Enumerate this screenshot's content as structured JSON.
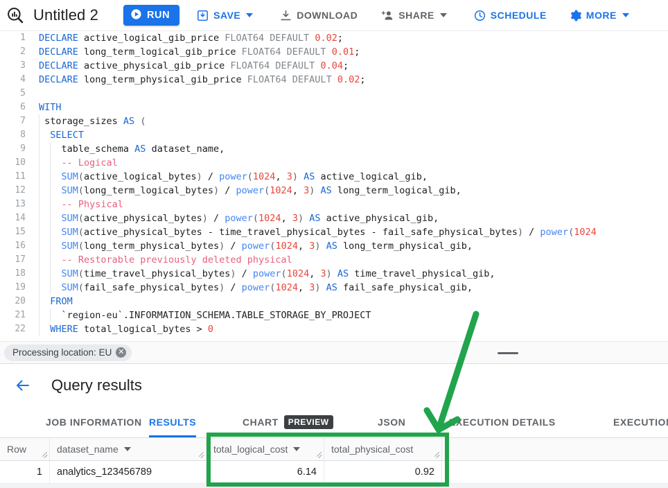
{
  "toolbar": {
    "logo_icon": "bigquery-search-icon",
    "title": "Untitled 2",
    "run_label": "RUN",
    "save_label": "SAVE",
    "download_label": "DOWNLOAD",
    "share_label": "SHARE",
    "schedule_label": "SCHEDULE",
    "more_label": "MORE",
    "accent_color": "#1a73e8",
    "disabled_color": "#5f6368"
  },
  "editor": {
    "lines": [
      {
        "n": "1",
        "html": "<span class='kw'>DECLARE</span> active_logical_gib_price <span class='typ'>FLOAT64</span> <span class='typ'>DEFAULT</span> <span class='num'>0.02</span>;"
      },
      {
        "n": "2",
        "html": "<span class='kw'>DECLARE</span> long_term_logical_gib_price <span class='typ'>FLOAT64</span> <span class='typ'>DEFAULT</span> <span class='num'>0.01</span>;"
      },
      {
        "n": "3",
        "html": "<span class='kw'>DECLARE</span> active_physical_gib_price <span class='typ'>FLOAT64</span> <span class='typ'>DEFAULT</span> <span class='num'>0.04</span>;"
      },
      {
        "n": "4",
        "html": "<span class='kw'>DECLARE</span> long_term_physical_gib_price <span class='typ'>FLOAT64</span> <span class='typ'>DEFAULT</span> <span class='num'>0.02</span>;"
      },
      {
        "n": "5",
        "html": ""
      },
      {
        "n": "6",
        "html": "<span class='kw'>WITH</span>"
      },
      {
        "n": "7",
        "html": " storage_sizes <span class='kw'>AS</span> <span class='pn'>(</span>"
      },
      {
        "n": "8",
        "html": "  <span class='kw'>SELECT</span>"
      },
      {
        "n": "9",
        "html": "    table_schema <span class='kw'>AS</span> dataset_name,"
      },
      {
        "n": "10",
        "html": "    <span class='cmt'>-- Logical</span>"
      },
      {
        "n": "11",
        "html": "    <span class='fn'>SUM</span><span class='pn'>(</span>active_logical_bytes<span class='pn'>)</span> / <span class='fn'>power</span><span class='pn'>(</span><span class='num'>1024</span>, <span class='num'>3</span><span class='pn'>)</span> <span class='kw'>AS</span> active_logical_gib,"
      },
      {
        "n": "12",
        "html": "    <span class='fn'>SUM</span><span class='pn'>(</span>long_term_logical_bytes<span class='pn'>)</span> / <span class='fn'>power</span><span class='pn'>(</span><span class='num'>1024</span>, <span class='num'>3</span><span class='pn'>)</span> <span class='kw'>AS</span> long_term_logical_gib,"
      },
      {
        "n": "13",
        "html": "    <span class='cmt'>-- Physical</span>"
      },
      {
        "n": "14",
        "html": "    <span class='fn'>SUM</span><span class='pn'>(</span>active_physical_bytes<span class='pn'>)</span> / <span class='fn'>power</span><span class='pn'>(</span><span class='num'>1024</span>, <span class='num'>3</span><span class='pn'>)</span> <span class='kw'>AS</span> active_physical_gib,"
      },
      {
        "n": "15",
        "html": "    <span class='fn'>SUM</span><span class='pn'>(</span>active_physical_bytes - time_travel_physical_bytes - fail_safe_physical_bytes<span class='pn'>)</span> / <span class='fn'>power</span><span class='pn'>(</span><span class='num'>1024</span>"
      },
      {
        "n": "16",
        "html": "    <span class='fn'>SUM</span><span class='pn'>(</span>long_term_physical_bytes<span class='pn'>)</span> / <span class='fn'>power</span><span class='pn'>(</span><span class='num'>1024</span>, <span class='num'>3</span><span class='pn'>)</span> <span class='kw'>AS</span> long_term_physical_gib,"
      },
      {
        "n": "17",
        "html": "    <span class='cmt'>-- Restorable previously deleted physical</span>"
      },
      {
        "n": "18",
        "html": "    <span class='fn'>SUM</span><span class='pn'>(</span>time_travel_physical_bytes<span class='pn'>)</span> / <span class='fn'>power</span><span class='pn'>(</span><span class='num'>1024</span>, <span class='num'>3</span><span class='pn'>)</span> <span class='kw'>AS</span> time_travel_physical_gib,"
      },
      {
        "n": "19",
        "html": "    <span class='fn'>SUM</span><span class='pn'>(</span>fail_safe_physical_bytes<span class='pn'>)</span> / <span class='fn'>power</span><span class='pn'>(</span><span class='num'>1024</span>, <span class='num'>3</span><span class='pn'>)</span> <span class='kw'>AS</span> fail_safe_physical_gib,"
      },
      {
        "n": "20",
        "html": "  <span class='kw'>FROM</span>"
      },
      {
        "n": "21",
        "html": "    `region-eu`.INFORMATION_SCHEMA.TABLE_STORAGE_BY_PROJECT"
      },
      {
        "n": "22",
        "html": "  <span class='kw'>WHERE</span> total_logical_bytes &gt; <span class='num'>0</span>"
      }
    ]
  },
  "processing_bar": {
    "chip_label": "Processing location: EU",
    "chip_close_icon": "close-circle-icon",
    "drag_handle_icon": "drag-handle-icon"
  },
  "results_header": {
    "back_icon": "back-arrow-icon",
    "title": "Query results"
  },
  "tabs": [
    {
      "label": "JOB INFORMATION",
      "active": false,
      "badge": ""
    },
    {
      "label": "RESULTS",
      "active": true,
      "badge": ""
    },
    {
      "label": "CHART",
      "active": false,
      "badge": "PREVIEW"
    },
    {
      "label": "JSON",
      "active": false,
      "badge": ""
    },
    {
      "label": "EXECUTION DETAILS",
      "active": false,
      "badge": ""
    },
    {
      "label": "EXECUTION G",
      "active": false,
      "badge": ""
    }
  ],
  "table": {
    "columns": [
      {
        "key": "row",
        "label": "Row",
        "sortable": false,
        "numeric": true
      },
      {
        "key": "name",
        "label": "dataset_name",
        "sortable": true,
        "numeric": false
      },
      {
        "key": "log",
        "label": "total_logical_cost",
        "sortable": true,
        "numeric": true
      },
      {
        "key": "phy",
        "label": "total_physical_cost",
        "sortable": false,
        "numeric": true
      }
    ],
    "rows": [
      {
        "row": "1",
        "name": "analytics_123456789",
        "log": "6.14",
        "phy": "0.92"
      }
    ]
  },
  "annotations": {
    "highlight_color": "#21a44b",
    "arrow": "down-left-arrow",
    "box": "cost-columns-highlight-box"
  }
}
